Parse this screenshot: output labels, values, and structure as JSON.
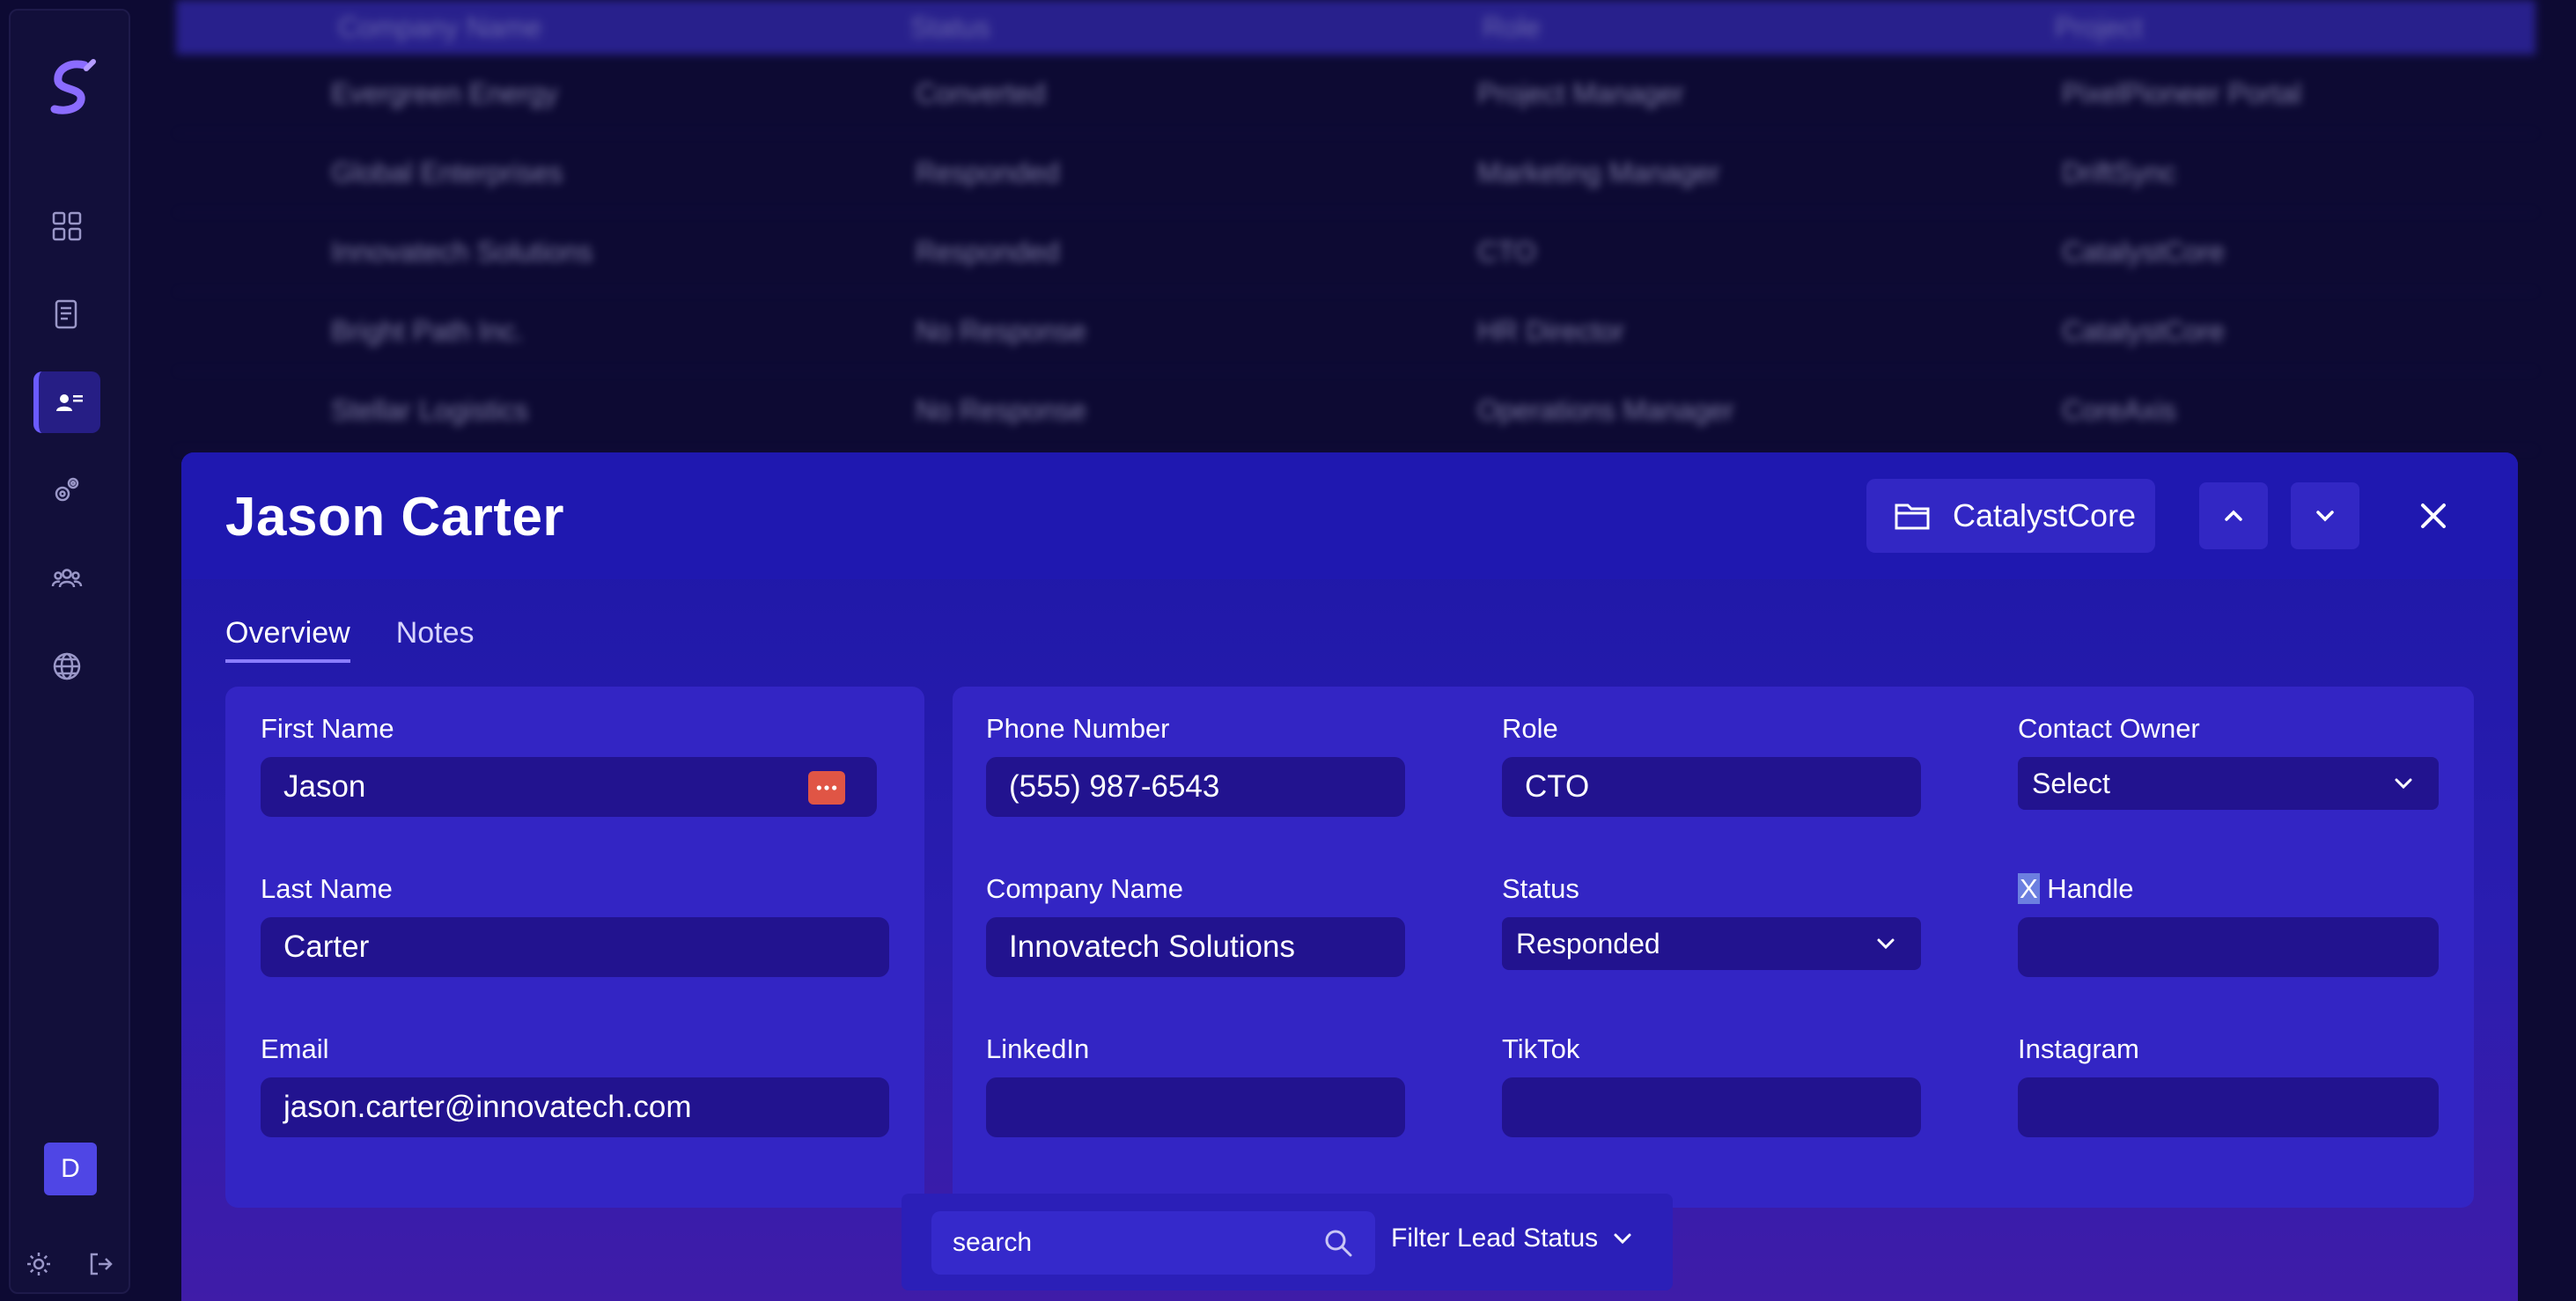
{
  "sidebar": {
    "avatar_letter": "D",
    "nav": [
      "dashboard-icon",
      "document-icon",
      "contacts-icon",
      "settings-gears-icon",
      "team-icon",
      "globe-icon"
    ],
    "active": "contacts-icon"
  },
  "background_table": {
    "headers": [
      "Company Name",
      "Status",
      "Role",
      "Project"
    ],
    "rows": [
      {
        "company": "Evergreen Energy",
        "status": "Converted",
        "role": "Project Manager",
        "project": "PixelPioneer Portal"
      },
      {
        "company": "Global Enterprises",
        "status": "Responded",
        "role": "Marketing Manager",
        "project": "DriftSync"
      },
      {
        "company": "Innovatech Solutions",
        "status": "Responded",
        "role": "CTO",
        "project": "CatalystCore"
      },
      {
        "company": "Bright Path Inc.",
        "status": "No Response",
        "role": "HR Director",
        "project": "CatalystCore"
      },
      {
        "company": "Stellar Logistics",
        "status": "No Response",
        "role": "Operations Manager",
        "project": "CoreAxis"
      }
    ]
  },
  "modal": {
    "title": "Jason Carter",
    "project": "CatalystCore",
    "tabs": [
      "Overview",
      "Notes"
    ],
    "fields": {
      "first_name": {
        "label": "First Name",
        "value": "Jason"
      },
      "last_name": {
        "label": "Last Name",
        "value": "Carter"
      },
      "email": {
        "label": "Email",
        "value": "jason.carter@innovatech.com"
      },
      "phone": {
        "label": "Phone Number",
        "value": "(555) 987-6543"
      },
      "role": {
        "label": "Role",
        "value": "CTO"
      },
      "contact_owner": {
        "label": "Contact Owner",
        "value": "Select"
      },
      "company": {
        "label": "Company Name",
        "value": "Innovatech Solutions"
      },
      "status": {
        "label": "Status",
        "value": "Responded"
      },
      "x_handle": {
        "label_x": "X",
        "label_rest": " Handle",
        "value": ""
      },
      "linkedin": {
        "label": "LinkedIn",
        "value": ""
      },
      "tiktok": {
        "label": "TikTok",
        "value": ""
      },
      "instagram": {
        "label": "Instagram",
        "value": ""
      }
    }
  },
  "search_bar": {
    "placeholder": "search",
    "filter_label": "Filter Lead Status"
  }
}
